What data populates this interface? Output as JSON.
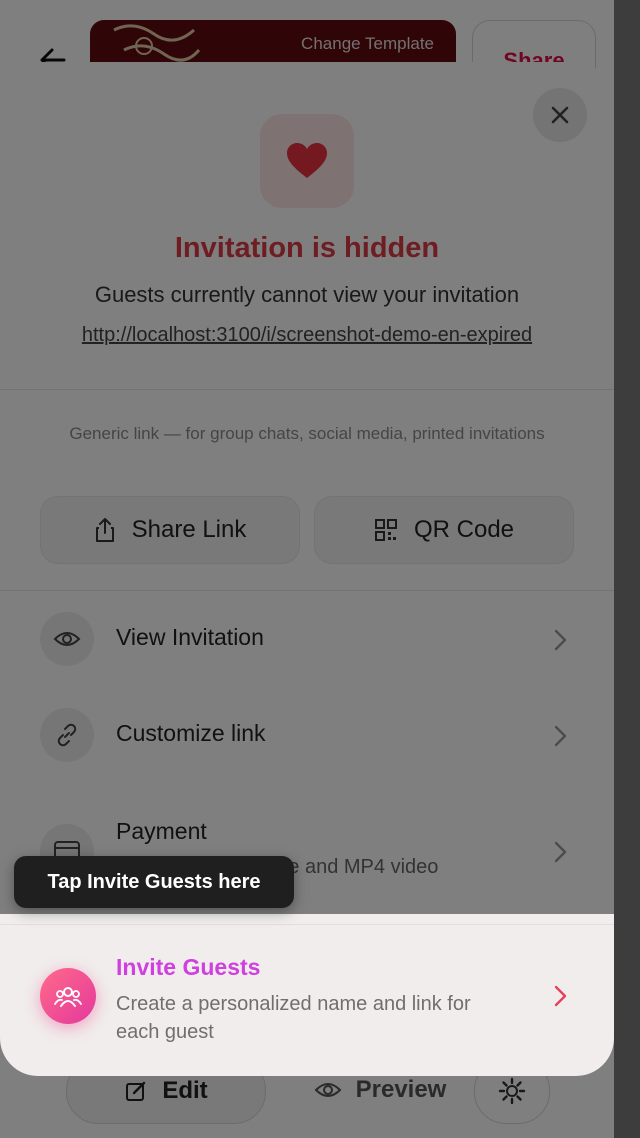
{
  "background": {
    "template_label": "Change Template",
    "share_label": "Share",
    "edit_label": "Edit",
    "preview_label": "Preview"
  },
  "sheet": {
    "status_title": "Invitation is hidden",
    "status_subtitle": "Guests currently cannot view your invitation",
    "url": "http://localhost:3100/i/screenshot-demo-en-expired",
    "generic_note": "Generic link — for group chats, social media, printed invitations",
    "share_link_label": "Share Link",
    "qr_code_label": "QR Code",
    "menu": {
      "view_invitation": "View Invitation",
      "customize_link": "Customize link",
      "payment": "Payment",
      "payment_sub": "Includes PNG image and MP4 video"
    },
    "invite": {
      "title": "Invite Guests",
      "description": "Create a personalized name and link for each guest"
    }
  },
  "tooltip": "Tap Invite Guests here",
  "colors": {
    "accent_red": "#dc3a46",
    "invite_title": "#d03fdf",
    "share_pink": "#e0114a",
    "template_bg": "#5e0a10"
  },
  "icons": [
    "back-arrow-icon",
    "close-icon",
    "heart-icon",
    "share-icon",
    "qr-code-icon",
    "eye-icon",
    "link-icon",
    "card-icon",
    "chevron-right-icon",
    "group-icon",
    "pencil-icon",
    "gear-icon"
  ]
}
